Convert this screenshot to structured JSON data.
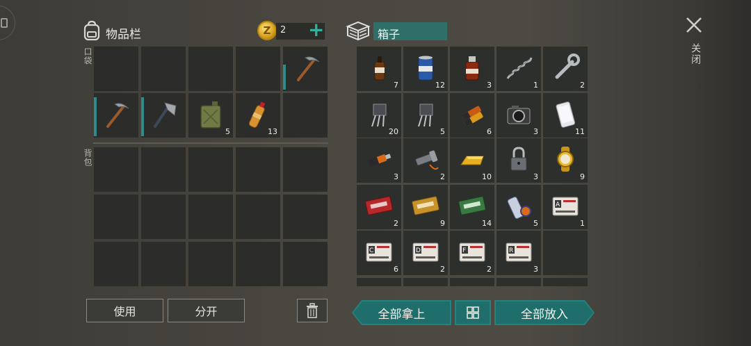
{
  "inventory": {
    "title": "物品栏",
    "coins": "2",
    "pocket_label": "口袋",
    "backpack_label": "背包",
    "pocket_slots": [
      {
        "icon": "empty",
        "count": ""
      },
      {
        "icon": "empty",
        "count": ""
      },
      {
        "icon": "empty",
        "count": ""
      },
      {
        "icon": "empty",
        "count": ""
      },
      {
        "icon": "pickaxe-icon",
        "count": ""
      },
      {
        "icon": "pickaxe-icon",
        "count": ""
      },
      {
        "icon": "hatchet-icon",
        "count": ""
      },
      {
        "icon": "jerrycan-icon",
        "count": "5"
      },
      {
        "icon": "water-bottle-icon",
        "count": "13"
      },
      {
        "icon": "empty",
        "count": ""
      }
    ],
    "use_label": "使用",
    "split_label": "分开"
  },
  "box": {
    "title": "箱子",
    "slots": [
      {
        "icon": "whiskey-bottle-icon",
        "count": "7"
      },
      {
        "icon": "beer-can-icon",
        "count": "12"
      },
      {
        "icon": "medicine-bottle-icon",
        "count": "3"
      },
      {
        "icon": "spring-icon",
        "count": "1"
      },
      {
        "icon": "wrench-icon",
        "count": "2"
      },
      {
        "icon": "transistor-icon",
        "count": "20"
      },
      {
        "icon": "transistor-icon",
        "count": "5"
      },
      {
        "icon": "batteries-icon",
        "count": "6"
      },
      {
        "icon": "camera-icon",
        "count": "3"
      },
      {
        "icon": "smartphone-icon",
        "count": "11"
      },
      {
        "icon": "usb-drive-icon",
        "count": "3"
      },
      {
        "icon": "flashlight-icon",
        "count": "2"
      },
      {
        "icon": "gold-bar-icon",
        "count": "10"
      },
      {
        "icon": "padlock-icon",
        "count": "3"
      },
      {
        "icon": "gold-watch-icon",
        "count": "9"
      },
      {
        "icon": "combat-coupon-icon",
        "count": "2"
      },
      {
        "icon": "chemical-coupon-icon",
        "count": "9"
      },
      {
        "icon": "ration-coupon-icon",
        "count": "14"
      },
      {
        "icon": "map-icon",
        "count": "5"
      },
      {
        "icon": "army-card-a-icon",
        "count": "1"
      },
      {
        "icon": "army-card-c-icon",
        "count": "6"
      },
      {
        "icon": "army-card-d-icon",
        "count": "2"
      },
      {
        "icon": "army-card-f-icon",
        "count": "2"
      },
      {
        "icon": "army-card-r-icon",
        "count": "3"
      },
      {
        "icon": "empty",
        "count": ""
      }
    ],
    "take_all_label": "全部拿上",
    "put_all_label": "全部放入"
  },
  "close_label": "关闭",
  "colors": {
    "accent": "#24827f",
    "coin": "#d4a020",
    "plus": "#2fb39a"
  }
}
